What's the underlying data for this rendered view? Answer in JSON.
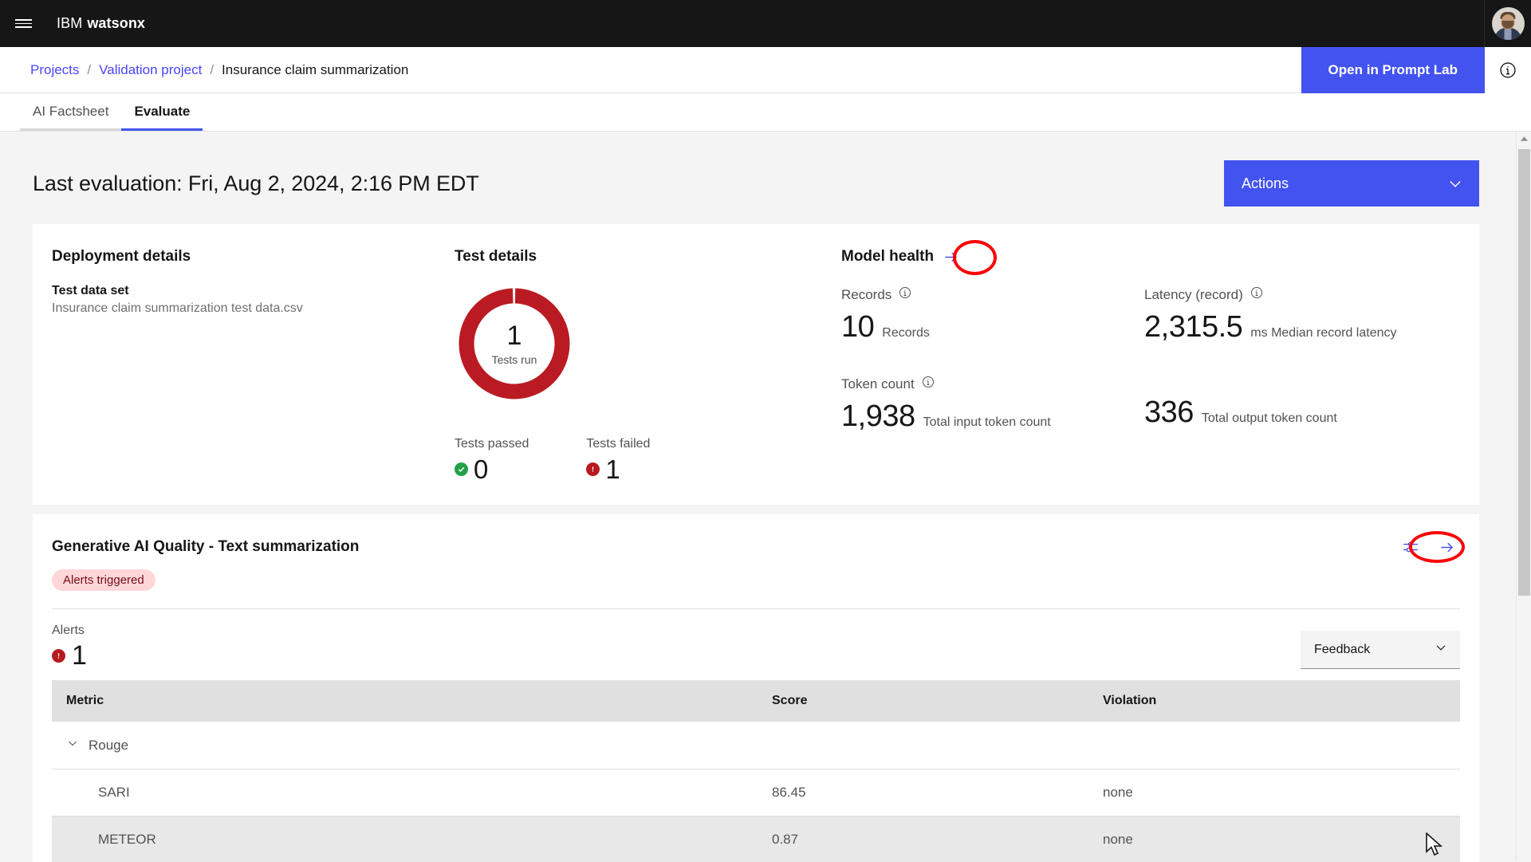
{
  "header": {
    "menu_icon": "hamburger-menu-icon",
    "brand_prefix": "IBM",
    "brand_name": "watsonx",
    "avatar_alt": "user-avatar"
  },
  "breadcrumb": {
    "items": [
      {
        "label": "Projects",
        "link": true
      },
      {
        "label": "Validation project",
        "link": true
      },
      {
        "label": "Insurance claim summarization",
        "link": false
      }
    ],
    "separator": "/",
    "prompt_lab_button": "Open in Prompt Lab",
    "info_icon": "information-icon"
  },
  "tabs": [
    {
      "label": "AI Factsheet",
      "active": false
    },
    {
      "label": "Evaluate",
      "active": true
    }
  ],
  "page": {
    "title": "Last evaluation: Fri, Aug 2, 2024, 2:16 PM EDT",
    "actions_label": "Actions",
    "actions_chevron": "chevron-down-icon"
  },
  "deployment": {
    "section_title": "Deployment details",
    "test_data_set_label": "Test data set",
    "test_data_set_value": "Insurance claim summarization test data.csv"
  },
  "test_details": {
    "section_title": "Test details",
    "donut_value": "1",
    "donut_caption": "Tests run",
    "donut_color": "#ba1b23",
    "passed_label": "Tests passed",
    "passed_value": "0",
    "passed_color": "#24a148",
    "failed_label": "Tests failed",
    "failed_value": "1",
    "failed_color": "#b81921"
  },
  "model_health": {
    "section_title": "Model health",
    "arrow_icon": "arrow-right-icon",
    "arrow_color": "#4353f0",
    "annotation_color": "#fe0000",
    "metrics": [
      {
        "label": "Records",
        "info_icon": "information-icon",
        "value": "10",
        "unit": "Records"
      },
      {
        "label": "Latency (record)",
        "info_icon": "information-icon",
        "value": "2,315.5",
        "unit": "ms Median record latency"
      },
      {
        "label": "Token count",
        "info_icon": "information-icon",
        "value": "1,938",
        "unit": "Total input token count"
      },
      {
        "label": "",
        "info_icon": "",
        "value": "336",
        "unit": "Total output token count"
      }
    ]
  },
  "quality": {
    "title": "Generative AI Quality - Text summarization",
    "tag": "Alerts triggered",
    "tag_bg": "#ffd7d9",
    "tag_fg": "#750e13",
    "settings_icon": "sliders-icon",
    "arrow_icon": "arrow-right-icon",
    "alerts_label": "Alerts",
    "alerts_value": "1",
    "feedback_label": "Feedback",
    "feedback_chevron": "chevron-down-icon",
    "table": {
      "columns": [
        "Metric",
        "Score",
        "Violation"
      ],
      "rows": [
        {
          "type": "group",
          "chevron": "chevron-down-icon",
          "metric": "Rouge",
          "score": "",
          "violation": ""
        },
        {
          "type": "metric",
          "metric": "SARI",
          "score": "86.45",
          "violation": "none"
        },
        {
          "type": "metric",
          "metric": "METEOR",
          "score": "0.87",
          "violation": "none"
        }
      ]
    }
  },
  "scrollbar": {
    "up_arrow_icon": "caret-up-icon"
  }
}
